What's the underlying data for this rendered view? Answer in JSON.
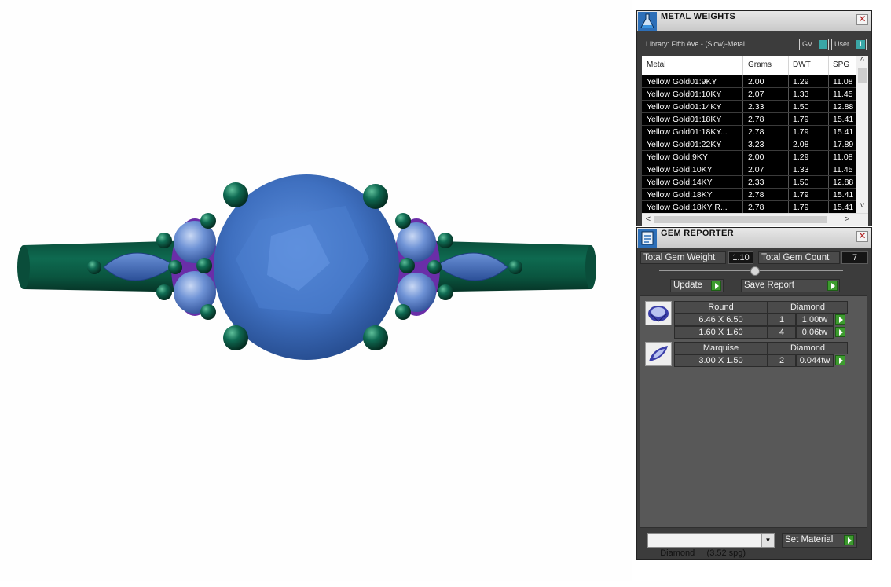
{
  "metal_weights": {
    "title": "METAL WEIGHTS",
    "close_icon": "close-icon",
    "library": "Library: Fifth Ave - (Slow)-Metal",
    "toggle_gv": "GV",
    "toggle_user": "User",
    "knob": "I",
    "columns": [
      "Metal",
      "Grams",
      "DWT",
      "SPG"
    ],
    "rows": [
      [
        "Yellow Gold01:9KY",
        "2.00",
        "1.29",
        "11.08"
      ],
      [
        "Yellow Gold01:10KY",
        "2.07",
        "1.33",
        "11.45"
      ],
      [
        "Yellow Gold01:14KY",
        "2.33",
        "1.50",
        "12.88"
      ],
      [
        "Yellow Gold01:18KY",
        "2.78",
        "1.79",
        "15.41"
      ],
      [
        "Yellow Gold01:18KY...",
        "2.78",
        "1.79",
        "15.41"
      ],
      [
        "Yellow Gold01:22KY",
        "3.23",
        "2.08",
        "17.89"
      ],
      [
        "Yellow Gold:9KY",
        "2.00",
        "1.29",
        "11.08"
      ],
      [
        "Yellow Gold:10KY",
        "2.07",
        "1.33",
        "11.45"
      ],
      [
        "Yellow Gold:14KY",
        "2.33",
        "1.50",
        "12.88"
      ],
      [
        "Yellow Gold:18KY",
        "2.78",
        "1.79",
        "15.41"
      ],
      [
        "Yellow Gold:18KY R...",
        "2.78",
        "1.79",
        "15.41"
      ]
    ],
    "scroll_up": "^",
    "scroll_down": "v",
    "scroll_left": "<",
    "scroll_right": ">"
  },
  "gem_reporter": {
    "title": "GEM REPORTER",
    "total_weight_label": "Total Gem Weight",
    "total_weight_value": "1.10",
    "total_count_label": "Total Gem Count",
    "total_count_value": "7",
    "update_label": "Update",
    "save_label": "Save Report",
    "groups": [
      {
        "shape": "Round",
        "material": "Diamond",
        "icon": "round-gem-icon",
        "rows": [
          {
            "size": "6.46 X 6.50",
            "count": "1",
            "weight": "1.00tw"
          },
          {
            "size": "1.60 X 1.60",
            "count": "4",
            "weight": "0.06tw"
          }
        ]
      },
      {
        "shape": "Marquise",
        "material": "Diamond",
        "icon": "marquise-gem-icon",
        "rows": [
          {
            "size": "3.00 X 1.50",
            "count": "2",
            "weight": "0.044tw"
          }
        ]
      }
    ],
    "material_select": "Diamond     (3.52 spg)",
    "set_material_label": "Set Material"
  },
  "colors": {
    "metal": "#0d5b45",
    "gem": "#3f72c2",
    "prong": "#0f6a52",
    "accent_purple": "#7a3ab5",
    "button_green": "#3d9b2f"
  }
}
